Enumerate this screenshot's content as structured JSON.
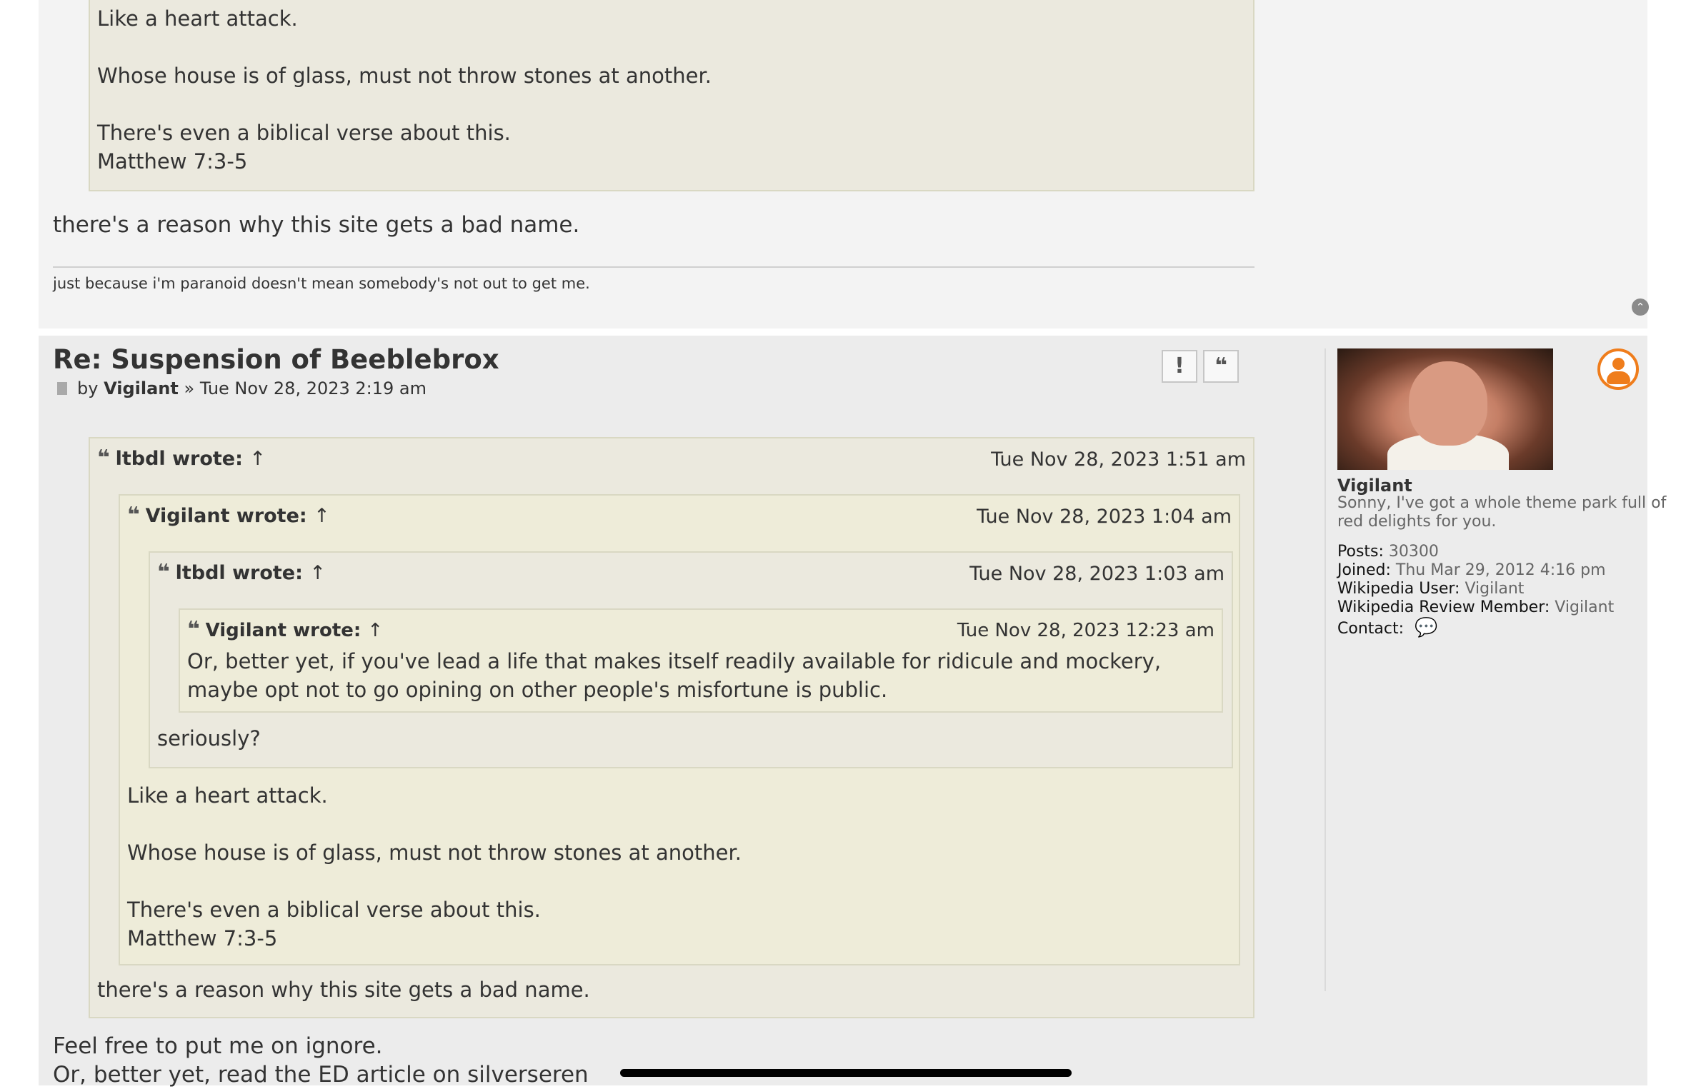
{
  "post1": {
    "quote_lines": [
      "Like a heart attack.",
      "Whose house is of glass, must not throw stones at another.",
      "There's even a biblical verse about this.",
      "Matthew 7:3-5"
    ],
    "body": "there's a reason why this site gets a bad name.",
    "signature": "just because i'm paranoid doesn't mean somebody's not out to get me."
  },
  "post2": {
    "title": "Re: Suspension of Beeblebrox",
    "by_label": "by",
    "author": "Vigilant",
    "separator": "»",
    "date": "Tue Nov 28, 2023 2:19 am",
    "report_label": "!",
    "quote_button_label": "❝",
    "quote_icon": "❝",
    "arrow": "↑",
    "quotes": {
      "q1": {
        "author": "ltbdl wrote:",
        "time": "Tue Nov 28, 2023 1:51 am"
      },
      "q2": {
        "author": "Vigilant wrote:",
        "time": "Tue Nov 28, 2023 1:04 am"
      },
      "q3": {
        "author": "ltbdl wrote:",
        "time": "Tue Nov 28, 2023 1:03 am"
      },
      "q4": {
        "author": "Vigilant wrote:",
        "time": "Tue Nov 28, 2023 12:23 am",
        "text": "Or, better yet, if you've lead a life that makes itself readily available for ridicule and mockery, maybe opt not to go opining on other people's misfortune is public."
      }
    },
    "q3_text": "seriously?",
    "q2_lines": [
      "Like a heart attack.",
      "Whose house is of glass, must not throw stones at another.",
      "There's even a biblical verse about this.",
      "Matthew 7:3-5"
    ],
    "q1_text": "there's a reason why this site gets a bad name.",
    "body_lines": [
      "Feel free to put me on ignore.",
      "Or, better yet, read the ED article on silverseren"
    ]
  },
  "profile": {
    "username": "Vigilant",
    "rank": "Sonny, I've got a whole theme park full of red delights for you.",
    "posts_label": "Posts:",
    "posts_value": "30300",
    "joined_label": "Joined:",
    "joined_value": "Thu Mar 29, 2012 4:16 pm",
    "wp_user_label": "Wikipedia User:",
    "wp_user_value": "Vigilant",
    "wr_member_label": "Wikipedia Review Member:",
    "wr_member_value": "Vigilant",
    "contact_label": "Contact:"
  },
  "colors": {
    "post_bg_1": "#f3f3f3",
    "post_bg_2": "#ececec",
    "quote_bg": "#ebe9de",
    "quote_alt_bg": "#eeecd9",
    "online_orange": "#ef7d1c"
  }
}
